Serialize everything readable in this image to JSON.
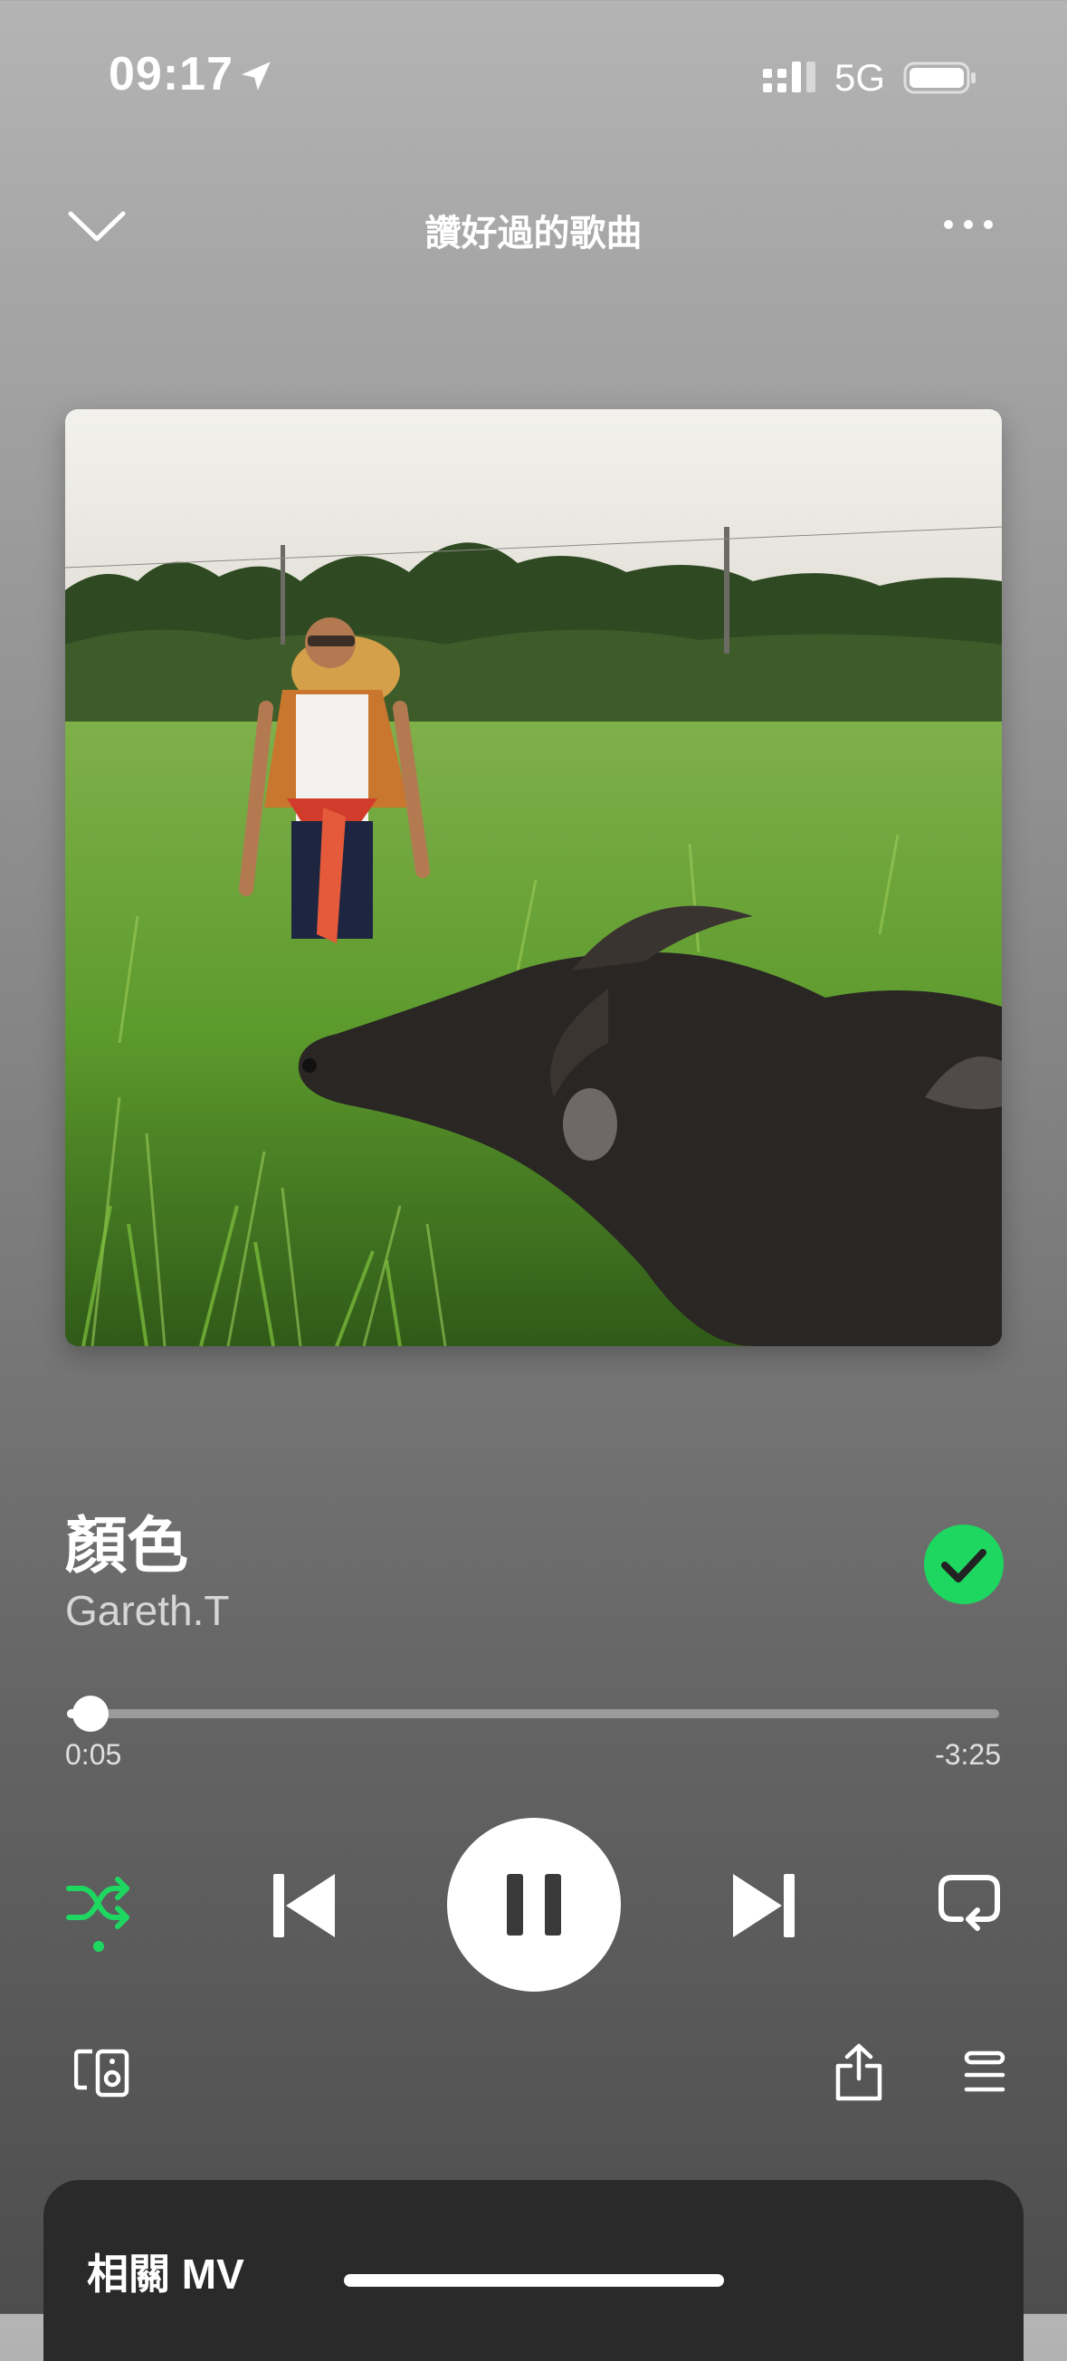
{
  "status_bar": {
    "time": "09:17",
    "network": "5G",
    "icons": [
      "location-arrow-icon",
      "signal-icon",
      "battery-icon"
    ]
  },
  "header": {
    "playlist_title": "讚好過的歌曲",
    "icons": [
      "chevron-down-icon",
      "more-icon"
    ]
  },
  "track": {
    "title": "顏色",
    "artist": "Gareth.T",
    "saved": true
  },
  "progress": {
    "elapsed": "0:05",
    "remaining": "-3:25",
    "fraction": 0.025
  },
  "controls": {
    "shuffle_active": true,
    "is_playing": true,
    "icons": [
      "shuffle-icon",
      "previous-icon",
      "pause-icon",
      "next-icon",
      "repeat-icon"
    ]
  },
  "bottom_bar": {
    "icons": [
      "devices-icon",
      "share-icon",
      "queue-icon"
    ]
  },
  "related_mv": {
    "title": "相關 MV"
  },
  "colors": {
    "accent": "#1ed760",
    "text_secondary": "#d6d6d6",
    "card_bg": "#2a2a2a"
  }
}
